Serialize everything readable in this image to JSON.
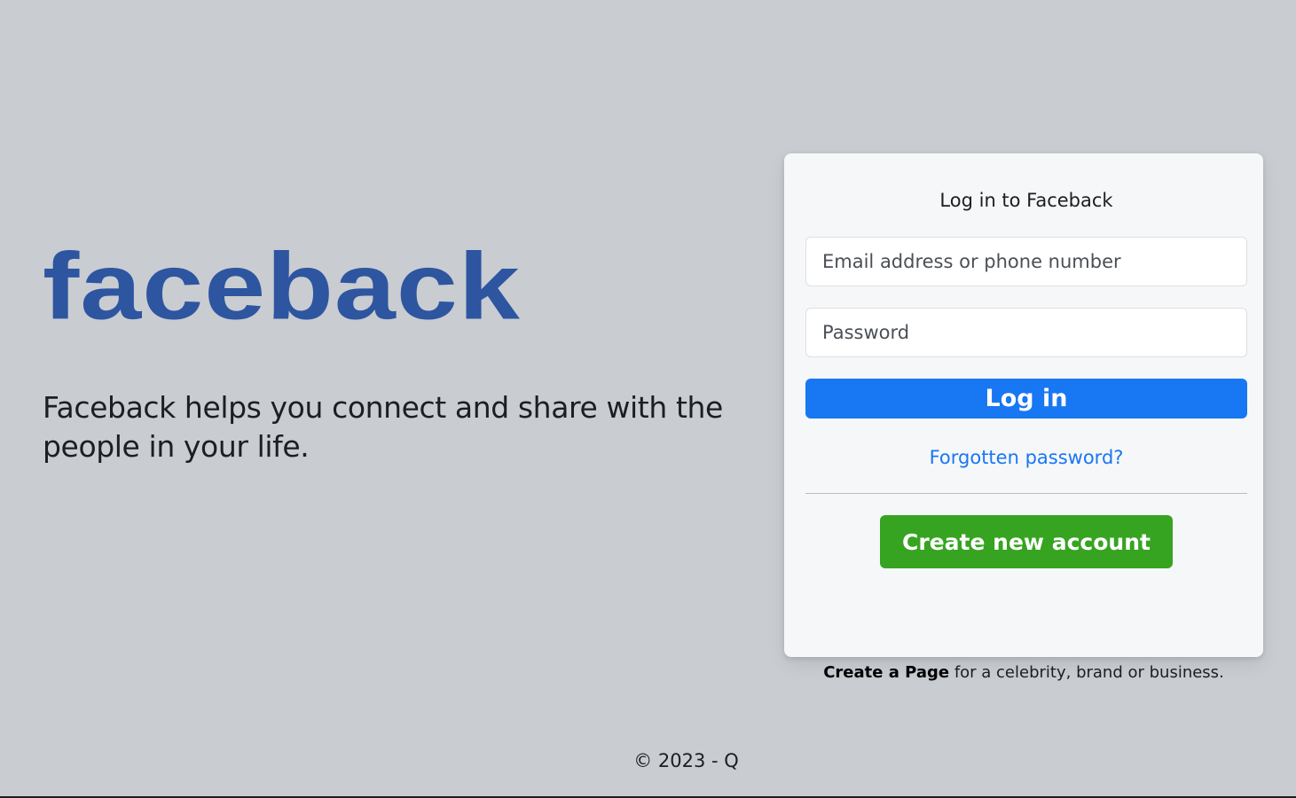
{
  "brand": {
    "logo_text": "faceback",
    "tagline": "Faceback helps you connect and share with the people in your life."
  },
  "login_card": {
    "title": "Log in to Faceback",
    "email_placeholder": "Email address or phone number",
    "email_value": "",
    "password_placeholder": "Password",
    "password_value": "",
    "login_label": "Log in",
    "forgot_label": "Forgotten password?",
    "create_label": "Create new account"
  },
  "page_note": {
    "link_label": "Create a Page",
    "rest": " for a celebrity, brand or business."
  },
  "footer": {
    "text": "© 2023 - Q"
  },
  "colors": {
    "background": "#c9ccd1",
    "logo": "#2d55a0",
    "primary": "#1877f2",
    "success": "#36a420",
    "card": "#f6f7f9"
  }
}
